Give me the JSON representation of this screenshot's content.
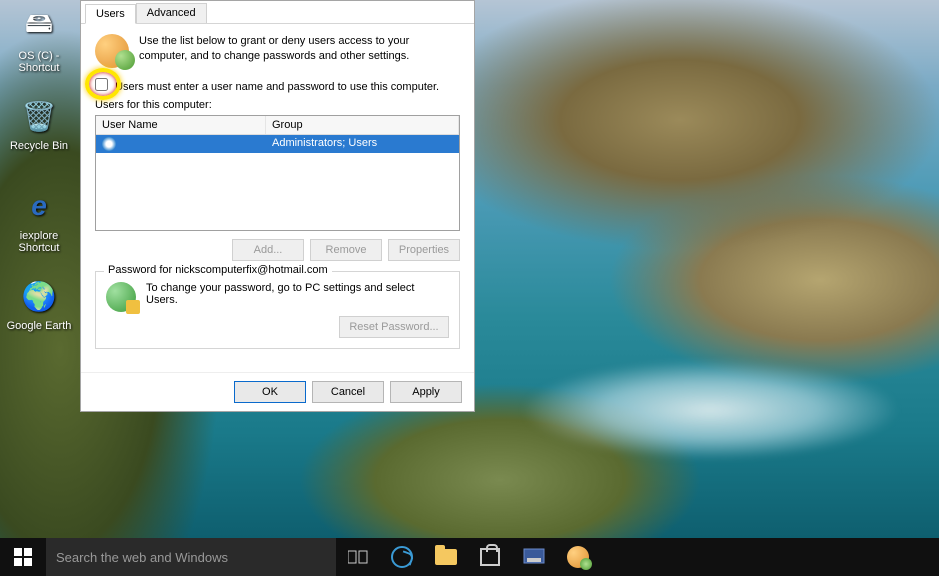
{
  "desktop": {
    "icons": [
      {
        "label": "OS (C) - Shortcut"
      },
      {
        "label": "Recycle Bin"
      },
      {
        "label": "iexplore Shortcut"
      },
      {
        "label": "Google Earth"
      }
    ]
  },
  "dialog": {
    "tabs": {
      "users": "Users",
      "advanced": "Advanced"
    },
    "intro": "Use the list below to grant or deny users access to your computer, and to change passwords and other settings.",
    "checkbox_label": "Users must enter a user name and password to use this computer.",
    "list_label": "Users for this computer:",
    "columns": {
      "user": "User Name",
      "group": "Group"
    },
    "rows": [
      {
        "user": "",
        "group": "Administrators; Users"
      }
    ],
    "buttons": {
      "add": "Add...",
      "remove": "Remove",
      "properties": "Properties"
    },
    "password_box": {
      "legend": "Password for nickscomputerfix@hotmail.com",
      "text": "To change your password, go to PC settings and select Users.",
      "reset": "Reset Password..."
    },
    "footer": {
      "ok": "OK",
      "cancel": "Cancel",
      "apply": "Apply"
    }
  },
  "taskbar": {
    "search_placeholder": "Search the web and Windows"
  }
}
